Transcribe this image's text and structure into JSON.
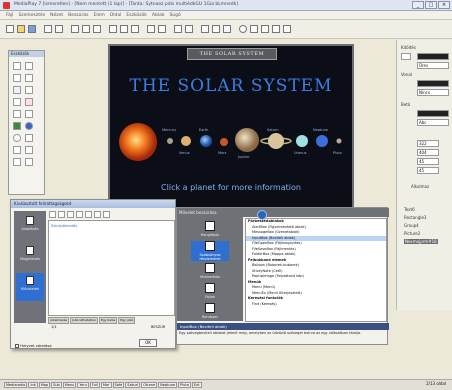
{
  "window": {
    "title": "MediaPlay 7 [ismeretlen] - [Nem mentett (1 lap)] - [Tanta: Sytnaez pdis multiédkGU 1Gia bLmnedk]"
  },
  "menus": [
    "Fájl",
    "Szerkesztés",
    "Nézet",
    "Beszúrás",
    "Elem",
    "Oldal",
    "Eszközök",
    "Ablak",
    "Súgó"
  ],
  "toolbox": {
    "title": "Eszközök"
  },
  "stage": {
    "banner": "THE SOLAR SYSTEM",
    "title": "THE SOLAR SYSTEM",
    "cta": "Click a planet for more information",
    "planet_labels": [
      "Mercury",
      "Earth",
      "Saturn",
      "Neptune",
      "Venus",
      "Mars",
      "Jupiter",
      "Uranus",
      "Pluto"
    ]
  },
  "props": {
    "fill_label": "Kitöltés",
    "fill_value": "Üres",
    "line_label": "Vonal",
    "line_value": "Nincs",
    "text_label": "Betű",
    "text_value": "Abc",
    "x": "322",
    "y": "404",
    "w": "45",
    "h": "45",
    "apply_label": "Alkalmaz"
  },
  "layers": [
    "Text6",
    "Rectangle3",
    "Group4",
    "Picture2",
    "Nexmojprm#18"
  ],
  "script_dialog": {
    "title": "Kiválasztott felirattagságokd",
    "side_items": [
      "Alaplépés",
      "Megjelenés",
      "Műveletek"
    ],
    "editor_text": "Szkriptkezdés",
    "tabs": [
      "Alkalmazás",
      "Jobb láthatatlan",
      "Egy balás",
      "Egy jobb"
    ],
    "status_left": "1/1",
    "status_right": "BESZÚR",
    "ok_label": "OK",
    "checkbox_label": "Helyzet zárolása"
  },
  "library": {
    "header": "Művelet beszúrása",
    "categories": [
      "Hangfájlok",
      "Szabványos részlelemek",
      "Multimédia",
      "Fájlok",
      "Rendszer"
    ],
    "items": [
      {
        "text": "Párbeszédablakok",
        "group": true
      },
      {
        "text": "AlertBox (Figyelmeztető ablak)"
      },
      {
        "text": "MessageBox (Üzenetablak)"
      },
      {
        "text": "InputBox (Beviteli ablak)",
        "selected": true
      },
      {
        "text": "FileOpenBox (Fájlmegnyitás)"
      },
      {
        "text": "FileSaveBox (Fájlmentés)"
      },
      {
        "text": "FolderBox (Mappa ablak)"
      },
      {
        "text": "Felbukkanó elemek",
        "group": true
      },
      {
        "text": "Balloon (Buborek-buborek)"
      },
      {
        "text": "StickyNote (Cetli)"
      },
      {
        "text": "PopUpImage (Felpattanó kép)"
      },
      {
        "text": "Menük",
        "group": true
      },
      {
        "text": "Menu (Menü)"
      },
      {
        "text": "MenuEx (Menü Kiterjesztett)"
      },
      {
        "text": "Keresési funkciók",
        "group": true
      },
      {
        "text": "Find (Keresés)"
      }
    ],
    "desc_title": "InputBox (Beviteli ablak)",
    "desc_text": "Egy szövegbeviteli ablakot jelenít meg, amelyben az üdvözlő szöveget beírva az egy változóban tárolja."
  },
  "bottom_tabs": [
    "Mediaradio",
    "Ink",
    "Map",
    "Sub",
    "Menu",
    "Yeru",
    "Full",
    "Mar",
    "Safe",
    "Sakuri",
    "Otume",
    "Neptune",
    "Pluto",
    "Ext"
  ],
  "zoom": "2/13 oldal"
}
